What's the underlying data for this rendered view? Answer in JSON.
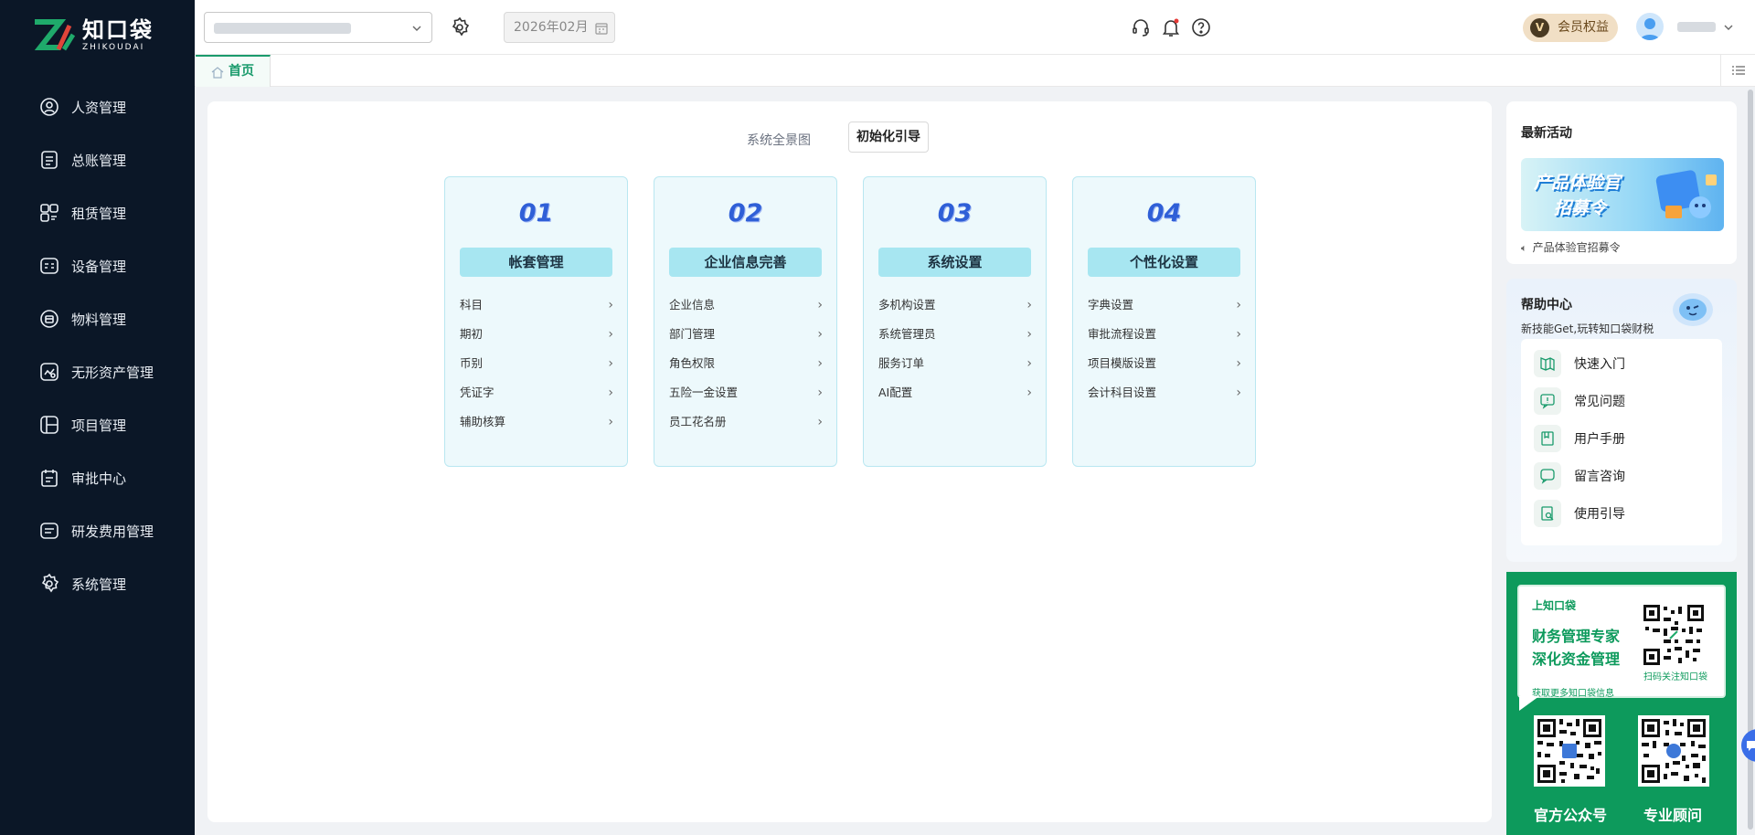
{
  "brand": {
    "name_cn": "知口袋",
    "name_en": "ZHIKOUDAI"
  },
  "sidebar": {
    "items": [
      {
        "label": "人资管理",
        "icon": "user-badge-icon"
      },
      {
        "label": "总账管理",
        "icon": "ledger-icon"
      },
      {
        "label": "租赁管理",
        "icon": "lease-icon"
      },
      {
        "label": "设备管理",
        "icon": "device-icon"
      },
      {
        "label": "物料管理",
        "icon": "material-icon"
      },
      {
        "label": "无形资产管理",
        "icon": "intangible-asset-icon"
      },
      {
        "label": "项目管理",
        "icon": "project-icon"
      },
      {
        "label": "审批中心",
        "icon": "approval-icon"
      },
      {
        "label": "研发费用管理",
        "icon": "rd-expense-icon"
      },
      {
        "label": "系统管理",
        "icon": "gear-icon"
      }
    ]
  },
  "topbar": {
    "period": "2026年02月",
    "vip_label": "会员权益",
    "vip_badge": "V"
  },
  "tabs": {
    "home": "首页"
  },
  "guide": {
    "overview_label": "系统全景图",
    "init_button": "初始化引导",
    "steps": [
      {
        "num": "01",
        "title": "帐套管理",
        "items": [
          "科目",
          "期初",
          "币别",
          "凭证字",
          "辅助核算"
        ]
      },
      {
        "num": "02",
        "title": "企业信息完善",
        "items": [
          "企业信息",
          "部门管理",
          "角色权限",
          "五险一金设置",
          "员工花名册"
        ]
      },
      {
        "num": "03",
        "title": "系统设置",
        "items": [
          "多机构设置",
          "系统管理员",
          "服务订单",
          "AI配置"
        ]
      },
      {
        "num": "04",
        "title": "个性化设置",
        "items": [
          "字典设置",
          "审批流程设置",
          "项目模版设置",
          "会计科目设置"
        ]
      }
    ]
  },
  "activity": {
    "title": "最新活动",
    "banner_line1": "产品体验官",
    "banner_line2": "招募令",
    "caption": "产品体验官招募令"
  },
  "help": {
    "title": "帮助中心",
    "subtitle": "新技能Get,玩转知口袋财税",
    "items": [
      {
        "label": "快速入门",
        "icon": "book-open-icon"
      },
      {
        "label": "常见问题",
        "icon": "question-bubble-icon"
      },
      {
        "label": "用户手册",
        "icon": "manual-icon"
      },
      {
        "label": "留言咨询",
        "icon": "message-icon"
      },
      {
        "label": "使用引导",
        "icon": "guide-doc-icon"
      }
    ]
  },
  "promo": {
    "tag": "上知口袋",
    "line1": "财务管理专家",
    "line2": "深化资金管理",
    "more": "获取更多知口袋信息",
    "scan": "扫码关注知口袋",
    "qr1_label": "官方公众号",
    "qr2_label": "专业顾问"
  },
  "colors": {
    "sidebar_bg": "#0b1727",
    "accent_green": "#1a9b6c",
    "step_blue": "#2f5fd7",
    "step_title_bg": "#a7e6f1",
    "promo_green": "#0d9a5c"
  }
}
